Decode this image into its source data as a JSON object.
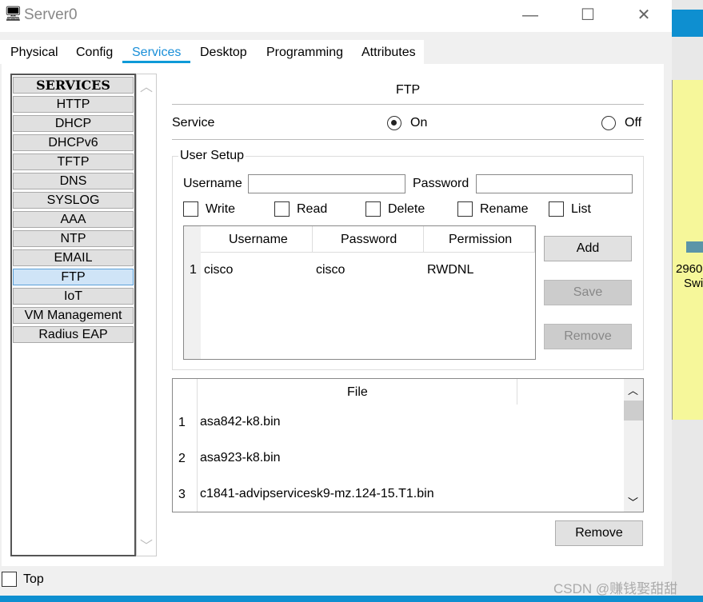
{
  "window": {
    "title": "Server0",
    "minimize": "—",
    "maximize": "☐",
    "close": "✕"
  },
  "tabs": [
    {
      "label": "Physical"
    },
    {
      "label": "Config"
    },
    {
      "label": "Services",
      "active": true
    },
    {
      "label": "Desktop"
    },
    {
      "label": "Programming"
    },
    {
      "label": "Attributes"
    }
  ],
  "services": {
    "header": "SERVICES",
    "items": [
      "HTTP",
      "DHCP",
      "DHCPv6",
      "TFTP",
      "DNS",
      "SYSLOG",
      "AAA",
      "NTP",
      "EMAIL",
      "FTP",
      "IoT",
      "VM Management",
      "Radius EAP"
    ],
    "selected": "FTP"
  },
  "ftp": {
    "title": "FTP",
    "service_label": "Service",
    "on_label": "On",
    "off_label": "Off",
    "service_state": "On",
    "user_setup": "User Setup",
    "username_label": "Username",
    "password_label": "Password",
    "username_value": "",
    "password_value": "",
    "perms": [
      {
        "label": "Write",
        "checked": false
      },
      {
        "label": "Read",
        "checked": false
      },
      {
        "label": "Delete",
        "checked": false
      },
      {
        "label": "Rename",
        "checked": false
      },
      {
        "label": "List",
        "checked": false
      }
    ],
    "user_table": {
      "headers": [
        "Username",
        "Password",
        "Permission"
      ],
      "rows": [
        {
          "num": "1",
          "username": "cisco",
          "password": "cisco",
          "permission": "RWDNL"
        }
      ]
    },
    "add": "Add",
    "save": "Save",
    "remove": "Remove",
    "file_table": {
      "header": "File",
      "rows": [
        {
          "num": "1",
          "file": "asa842-k8.bin"
        },
        {
          "num": "2",
          "file": "asa923-k8.bin"
        },
        {
          "num": "3",
          "file": "c1841-advipservicesk9-mz.124-15.T1.bin"
        }
      ]
    },
    "file_remove": "Remove"
  },
  "footer": {
    "top_label": "Top",
    "top_checked": false
  },
  "background": {
    "device_label_1": "2960",
    "device_label_2": "Swi",
    "watermark": "CSDN @赚钱娶甜甜"
  },
  "colors": {
    "accent": "#0e8fd0",
    "selected_service": "#cfe4f7"
  }
}
